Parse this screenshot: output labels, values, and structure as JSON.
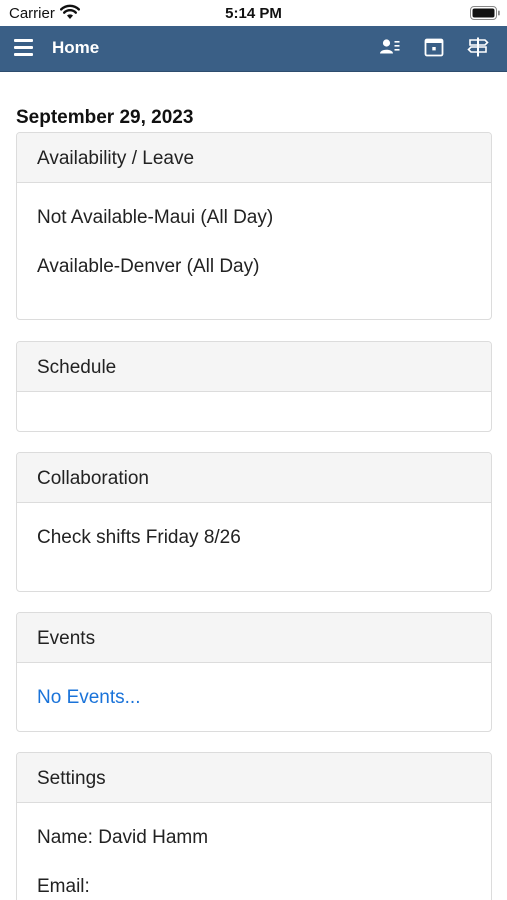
{
  "status_bar": {
    "carrier": "Carrier",
    "time": "5:14 PM"
  },
  "nav": {
    "title": "Home",
    "icons": [
      "menu-icon",
      "contact-list-icon",
      "calendar-icon",
      "signpost-icon"
    ],
    "bar_color": "#3a5f86"
  },
  "date": "September 29, 2023",
  "panels": {
    "availability": {
      "title": "Availability / Leave",
      "items": [
        "Not Available-Maui (All Day)",
        "Available-Denver (All Day)"
      ]
    },
    "schedule": {
      "title": "Schedule"
    },
    "collaboration": {
      "title": "Collaboration",
      "items": [
        "Check shifts Friday 8/26"
      ]
    },
    "events": {
      "title": "Events",
      "empty_text": "No Events..."
    },
    "settings": {
      "title": "Settings",
      "name": "Name: David Hamm",
      "email": "Email:"
    }
  },
  "colors": {
    "link": "#1a73d9",
    "header_bg": "#f5f5f5"
  }
}
